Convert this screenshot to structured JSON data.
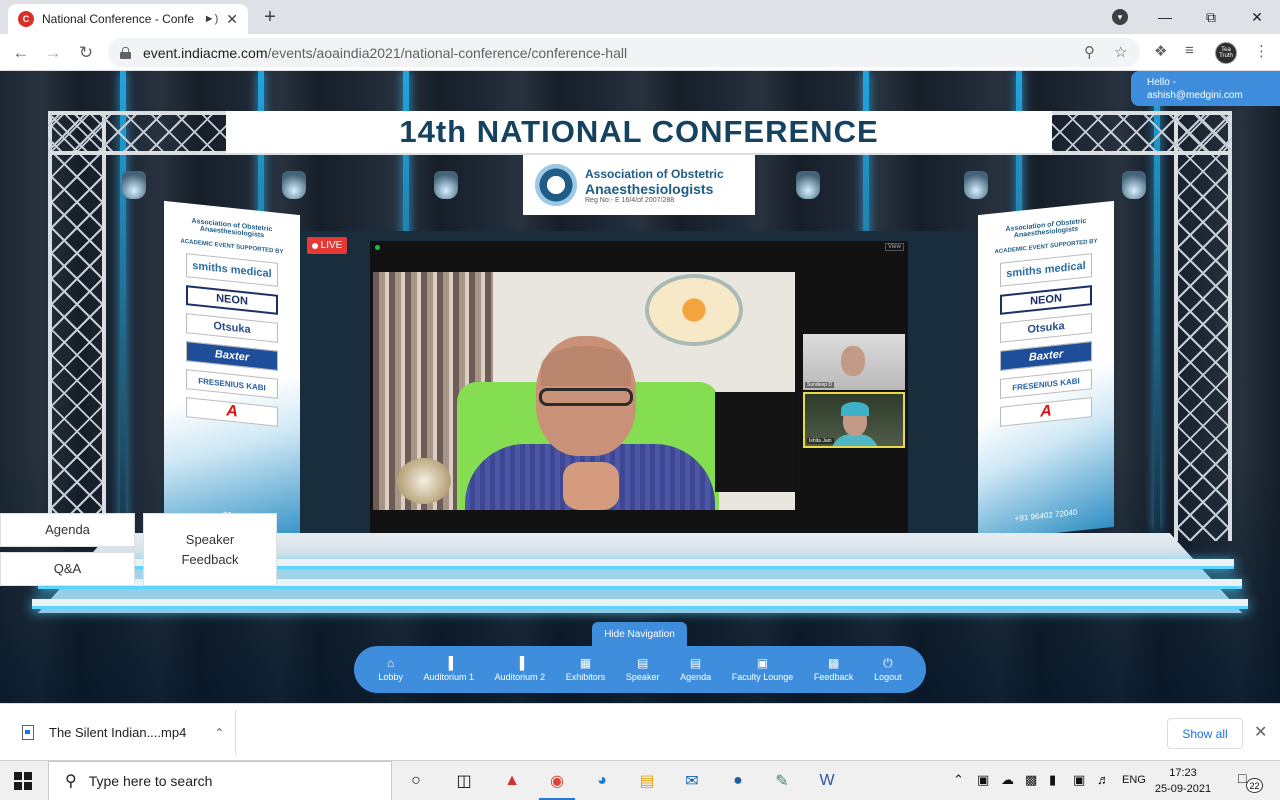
{
  "browser": {
    "tab_title": "National Conference - Confe",
    "tab_audio_icon": "speaker-icon",
    "new_tab": "+",
    "url_host": "event.indiacme.com",
    "url_path": "/events/aoaindia2021/national-conference/conference-hall",
    "avatar_text": "Tea Truth"
  },
  "user": {
    "greeting": "Hello -",
    "email": "ashish@medgini.com"
  },
  "stage": {
    "banner": "14th NATIONAL CONFERENCE",
    "org_line1": "Association of Obstetric",
    "org_line2": "Anaesthesiologists",
    "org_reg": "Reg No:- E 16/4/of 2007/288",
    "live_label": "LIVE",
    "view_label": "View",
    "thumb1_name": "Sundeep D",
    "thumb2_name": "Ishita Jain",
    "standee_left": {
      "head": "Association of Obstetric Anaesthesiologists",
      "sub": "ACADEMIC EVENT SUPPORTED BY",
      "sponsors": [
        "smiths medical",
        "NEON",
        "Otsuka",
        "Baxter",
        "FRESENIUS KABI",
        "A"
      ],
      "phone": "2040"
    },
    "standee_right": {
      "head": "Association of Obstetric Anaesthesiologists",
      "sub": "ACADEMIC EVENT SUPPORTED BY",
      "sponsors": [
        "smiths medical",
        "NEON",
        "Otsuka",
        "Baxter",
        "FRESENIUS KABI",
        "A"
      ],
      "phone": "+91 96402 72040"
    }
  },
  "side_buttons": {
    "agenda": "Agenda",
    "qa": "Q&A",
    "speaker_feedback_l1": "Speaker",
    "speaker_feedback_l2": "Feedback"
  },
  "navigation": {
    "hide_label": "Hide Navigation",
    "items": [
      {
        "label": "Lobby",
        "icon": "home-icon"
      },
      {
        "label": "Auditorium 1",
        "icon": "door-icon"
      },
      {
        "label": "Auditorium 2",
        "icon": "door-icon"
      },
      {
        "label": "Exhibitors",
        "icon": "booth-icon"
      },
      {
        "label": "Speaker",
        "icon": "document-icon"
      },
      {
        "label": "Agenda",
        "icon": "document-icon"
      },
      {
        "label": "Faculty Lounge",
        "icon": "lounge-icon"
      },
      {
        "label": "Feedback",
        "icon": "feedback-icon"
      },
      {
        "label": "Logout",
        "icon": "power-icon"
      }
    ]
  },
  "downloads": {
    "file_name": "The Silent Indian....mp4",
    "show_all": "Show all"
  },
  "taskbar": {
    "search_placeholder": "Type here to search",
    "language": "ENG",
    "time": "17:23",
    "date": "25-09-2021",
    "notification_count": "22"
  },
  "colors": {
    "accent_blue": "#3f8ede",
    "live_red": "#e53935",
    "banner_text": "#15425f"
  }
}
